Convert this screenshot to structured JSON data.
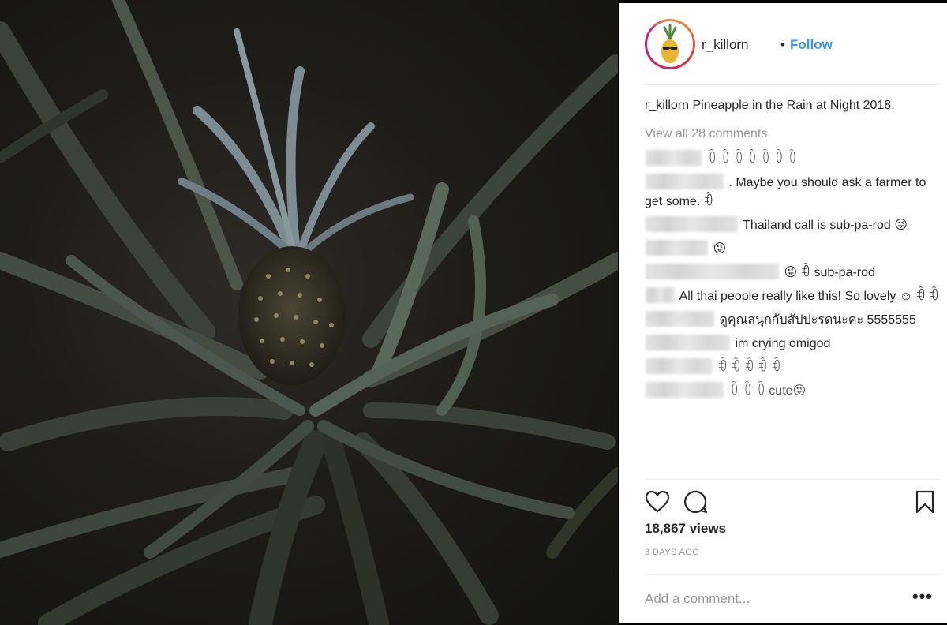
{
  "post": {
    "username": "r_killorn",
    "separator": "•",
    "follow_label": "Follow",
    "caption_user": "r_killorn",
    "caption_text": "Pineapple in the Rain at Night 2018.",
    "view_all": "View all 28 comments",
    "comments": [
      {
        "text": "ꊘ ꊘ ꊘ ꊘ ꊘ ꊘ ꊘ"
      },
      {
        "text": ". Maybe you should ask a farmer to get some. ꊘ"
      },
      {
        "text": "Thailand call is sub-pa-rod 😜"
      },
      {
        "text": "😜"
      },
      {
        "text": "😜 ꊘ sub-pa-rod"
      },
      {
        "text": "All thai people really like this! So lovely ☺ ꊘ ꊘ"
      },
      {
        "text": "ดูคุณสนุกกับสัปปะรดนะคะ 5555555"
      },
      {
        "text": "im crying omigod"
      },
      {
        "text": "ꊘ ꊘ ꊘ ꊘ ꊘ"
      },
      {
        "text": "ꊘ ꊘ ꊘ cute😜"
      }
    ],
    "views": "18,867 views",
    "date": "3 DAYS AGO",
    "add_comment_placeholder": "Add a comment...",
    "more_label": "•••"
  },
  "icons": {
    "like": "heart-icon",
    "comment": "comment-bubble-icon",
    "save": "bookmark-icon",
    "avatar": "pineapple-avatar"
  },
  "colors": {
    "follow": "#3897f0",
    "muted": "#999999",
    "text": "#262626"
  }
}
